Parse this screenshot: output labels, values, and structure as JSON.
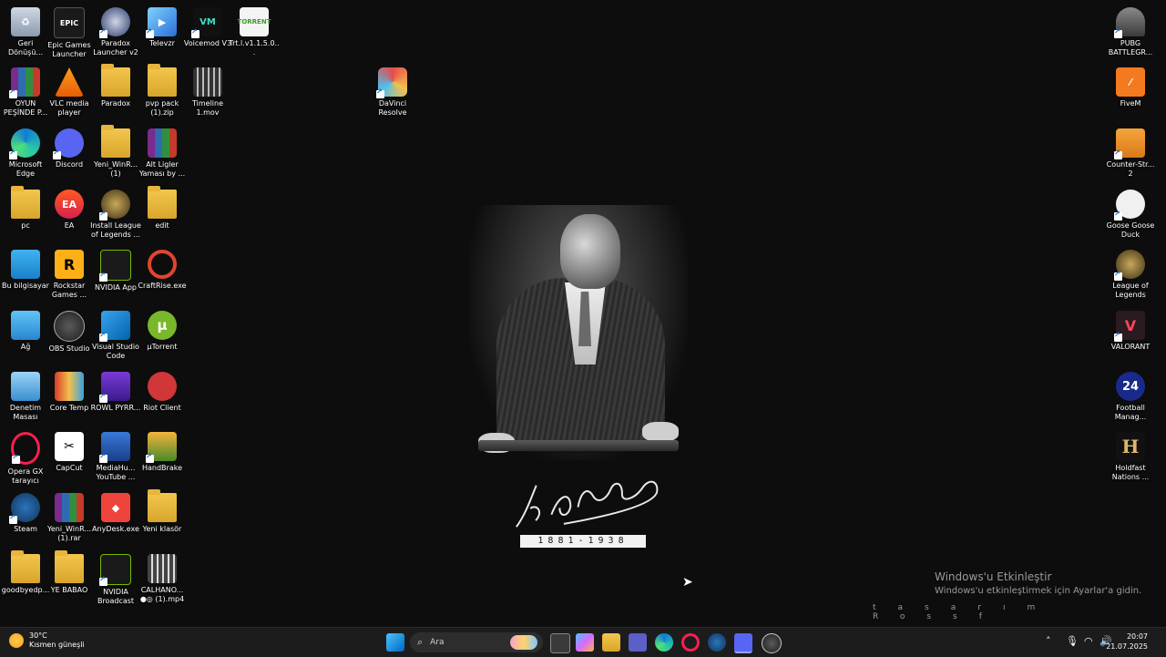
{
  "desktop": {
    "col1": [
      {
        "label": "Geri Dönüşü..."
      },
      {
        "label": "OYUN PEŞİNDE P..."
      },
      {
        "label": "Microsoft Edge"
      },
      {
        "label": "pc"
      },
      {
        "label": "Bu bilgisayar"
      },
      {
        "label": "Ağ"
      },
      {
        "label": "Denetim Masası"
      },
      {
        "label": "Opera GX tarayıcı"
      },
      {
        "label": "Steam"
      },
      {
        "label": "goodbyedp..."
      }
    ],
    "col2": [
      {
        "label": "Epic Games Launcher",
        "glyph": "EPIC"
      },
      {
        "label": "VLC media player"
      },
      {
        "label": "Discord"
      },
      {
        "label": "EA",
        "glyph": "EA"
      },
      {
        "label": "Rockstar Games ...",
        "glyph": "R"
      },
      {
        "label": "OBS Studio"
      },
      {
        "label": "Core Temp"
      },
      {
        "label": "CapCut"
      },
      {
        "label": "Yeni_WinR... (1).rar"
      },
      {
        "label": "YE BABAO"
      }
    ],
    "col3": [
      {
        "label": "Paradox Launcher v2"
      },
      {
        "label": "Paradox"
      },
      {
        "label": "Yeni_WinR... (1)"
      },
      {
        "label": "Install League of Legends ..."
      },
      {
        "label": "NVIDIA App"
      },
      {
        "label": "Visual Studio Code"
      },
      {
        "label": "ROWL PYRR..."
      },
      {
        "label": "MediaHu... YouTube ..."
      },
      {
        "label": "AnyDesk.exe"
      },
      {
        "label": "NVIDIA Broadcast"
      }
    ],
    "col4": [
      {
        "label": "Televzr"
      },
      {
        "label": "pvp pack (1).zip"
      },
      {
        "label": "Alt Ligler Yaması by ..."
      },
      {
        "label": "edit"
      },
      {
        "label": "CraftRise.exe"
      },
      {
        "label": "µTorrent"
      },
      {
        "label": "Riot Client"
      },
      {
        "label": "HandBrake"
      },
      {
        "label": "Yeni klasör"
      },
      {
        "label": "CALHANO... ●◎ (1).mp4"
      }
    ],
    "col5": [
      {
        "label": "Voicemod V3"
      },
      {
        "label": "Timeline 1.mov"
      }
    ],
    "col6": [
      {
        "label": "Trt.l.v1.1.5.0..."
      }
    ],
    "misc": [
      {
        "label": "DaVinci Resolve"
      }
    ],
    "right": [
      {
        "label": "PUBG BATTLEGR..."
      },
      {
        "label": "FiveM"
      },
      {
        "label": "Counter-Str... 2"
      },
      {
        "label": "Goose Goose Duck"
      },
      {
        "label": "League of Legends"
      },
      {
        "label": "VALORANT"
      },
      {
        "label": "Football Manag...",
        "glyph": "24"
      },
      {
        "label": "Holdfast Nations ...",
        "glyph": "H"
      }
    ]
  },
  "wallpaper": {
    "years": "1881-1938",
    "credit": "tasarım Rossf"
  },
  "activation": {
    "title": "Windows'u Etkinleştir",
    "subtitle": "Windows'u etkinleştirmek için Ayarlar'a gidin."
  },
  "taskbar": {
    "weather": {
      "temp": "30°C",
      "desc": "Kısmen güneşli"
    },
    "search_placeholder": "Ara",
    "clock": {
      "time": "20:07",
      "date": "21.07.2025"
    }
  }
}
